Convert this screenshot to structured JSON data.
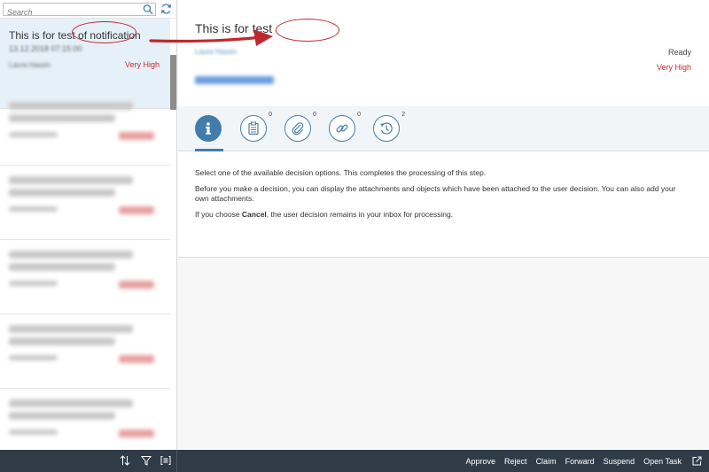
{
  "search": {
    "placeholder": "Search"
  },
  "list": {
    "selected": {
      "title": "This is for test of notification",
      "date": "13.12.2018 07:15:00",
      "author": "Laura Hassin",
      "priority": "Very High"
    }
  },
  "detail": {
    "title": "This is for test",
    "author": "Laura Hassin",
    "status": "Ready",
    "priority": "Very High",
    "tabs": [
      {
        "icon": "info-icon",
        "count": ""
      },
      {
        "icon": "notes-icon",
        "count": "0"
      },
      {
        "icon": "attachment-icon",
        "count": "0"
      },
      {
        "icon": "link-icon",
        "count": "0"
      },
      {
        "icon": "history-icon",
        "count": "2"
      }
    ],
    "content": {
      "p1": "Select one of the available decision options. This completes the processing of this step.",
      "p2": "Before you make a decision, you can display the attachments and objects which have been attached to the user decision. You can also add your own attachments.",
      "p3_before": "If you choose ",
      "p3_bold": "Cancel",
      "p3_after": ", the user decision remains in your inbox for processing."
    }
  },
  "footer": {
    "actions": [
      "Approve",
      "Reject",
      "Claim",
      "Forward",
      "Suspend",
      "Open Task"
    ]
  },
  "colors": {
    "accent": "#427cac",
    "priority": "#cc2a2a",
    "footer_bg": "#2f3c48",
    "annotation": "#c0282d"
  }
}
